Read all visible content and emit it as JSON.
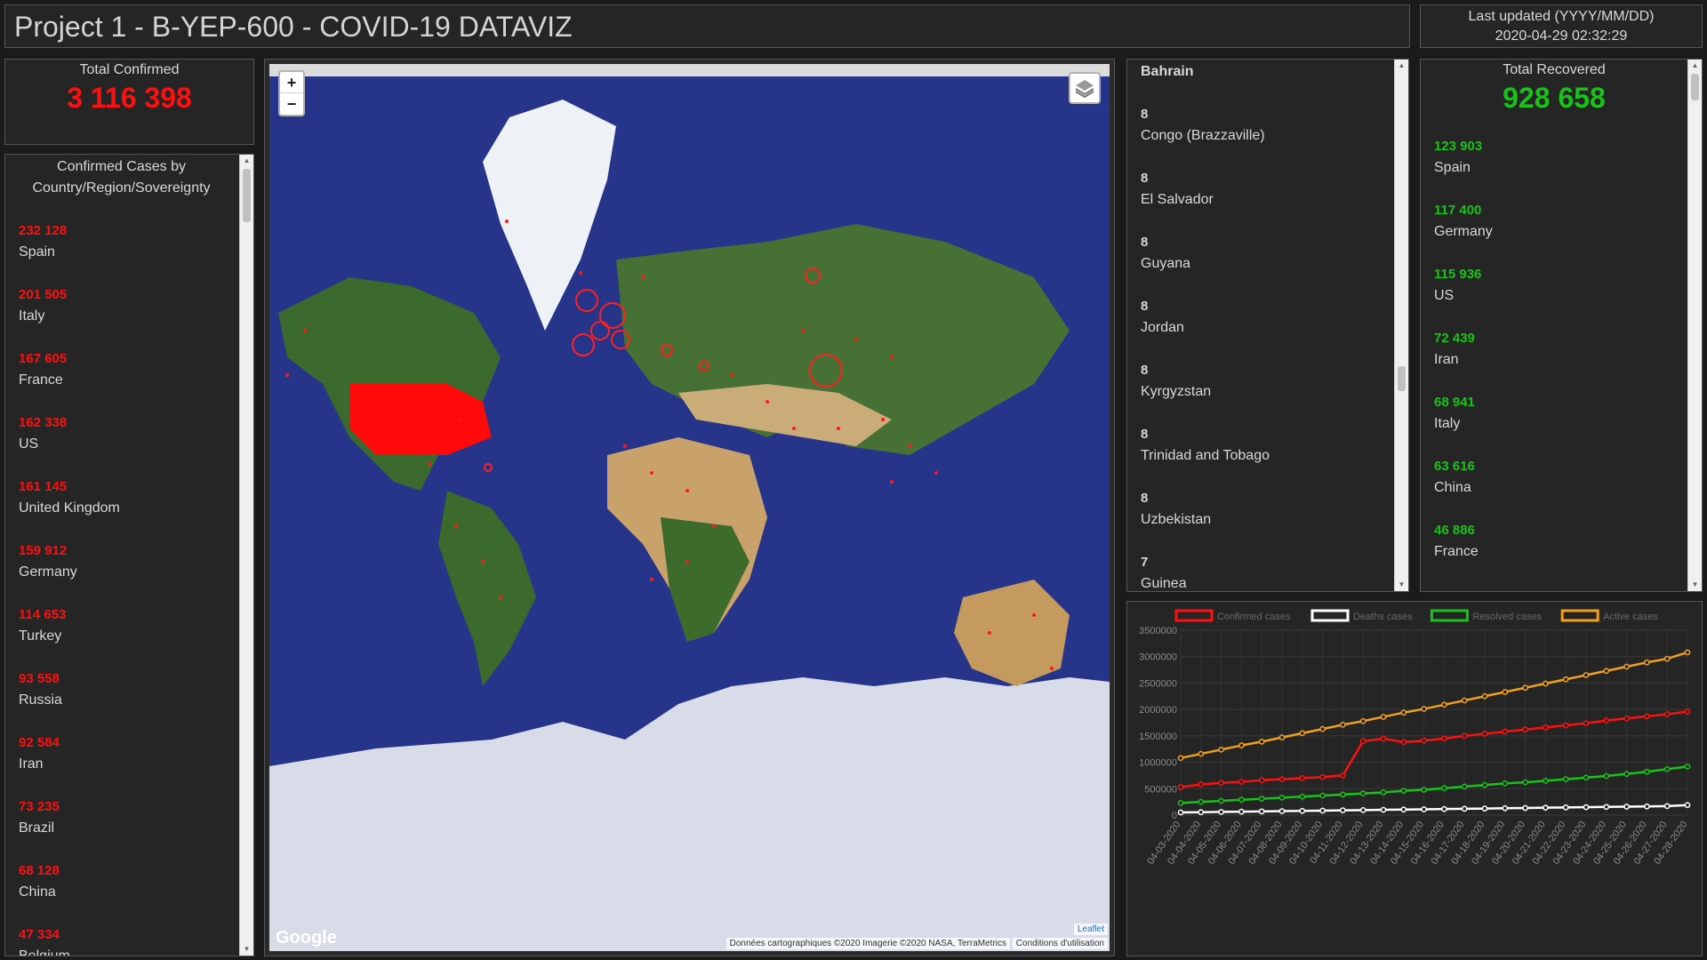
{
  "header": {
    "title": "Project 1 - B-YEP-600 - COVID-19 DATAVIZ"
  },
  "updated": {
    "label": "Last updated (YYYY/MM/DD)",
    "value": "2020-04-29 02:32:29"
  },
  "total_confirmed": {
    "label": "Total Confirmed",
    "value": "3 116 398"
  },
  "total_recovered": {
    "label": "Total Recovered",
    "value": "928 658"
  },
  "confirmed_list": {
    "title": "Confirmed Cases by Country/Region/Sovereignty",
    "items": [
      {
        "num": "232 128",
        "country": "Spain"
      },
      {
        "num": "201 505",
        "country": "Italy"
      },
      {
        "num": "167 605",
        "country": "France"
      },
      {
        "num": "162 338",
        "country": "US"
      },
      {
        "num": "161 145",
        "country": "United Kingdom"
      },
      {
        "num": "159 912",
        "country": "Germany"
      },
      {
        "num": "114 653",
        "country": "Turkey"
      },
      {
        "num": "93 558",
        "country": "Russia"
      },
      {
        "num": "92 584",
        "country": "Iran"
      },
      {
        "num": "73 235",
        "country": "Brazil"
      },
      {
        "num": "68 128",
        "country": "China"
      },
      {
        "num": "47 334",
        "country": "Belgium"
      }
    ]
  },
  "deaths_list": {
    "top_country": "Bahrain",
    "items": [
      {
        "num": "8",
        "country": "Congo (Brazzaville)"
      },
      {
        "num": "8",
        "country": "El Salvador"
      },
      {
        "num": "8",
        "country": "Guyana"
      },
      {
        "num": "8",
        "country": "Jordan"
      },
      {
        "num": "8",
        "country": "Kyrgyzstan"
      },
      {
        "num": "8",
        "country": "Trinidad and Tobago"
      },
      {
        "num": "8",
        "country": "Uzbekistan"
      },
      {
        "num": "7",
        "country": "Guinea"
      }
    ]
  },
  "recovered_list": {
    "items": [
      {
        "num": "123 903",
        "country": "Spain"
      },
      {
        "num": "117 400",
        "country": "Germany"
      },
      {
        "num": "115 936",
        "country": "US"
      },
      {
        "num": "72 439",
        "country": "Iran"
      },
      {
        "num": "68 941",
        "country": "Italy"
      },
      {
        "num": "63 616",
        "country": "China"
      },
      {
        "num": "46 886",
        "country": "France"
      }
    ]
  },
  "map": {
    "zoom_in": "+",
    "zoom_out": "−",
    "google_logo": "Google",
    "attribution": "Données cartographiques ©2020 Imagerie ©2020 NASA, TerraMetrics",
    "terms": "Conditions d'utilisation",
    "leaflet": "Leaflet",
    "layers_icon": "layers-icon"
  },
  "colors": {
    "confirmed": "#ff1010",
    "deaths": "#ffffff",
    "resolved": "#19c219",
    "active": "#f0a020"
  },
  "chart_data": {
    "type": "line",
    "x": [
      "04-03-2020",
      "04-04-2020",
      "04-05-2020",
      "04-06-2020",
      "04-07-2020",
      "04-08-2020",
      "04-09-2020",
      "04-10-2020",
      "04-11-2020",
      "04-12-2020",
      "04-13-2020",
      "04-14-2020",
      "04-15-2020",
      "04-16-2020",
      "04-17-2020",
      "04-18-2020",
      "04-19-2020",
      "04-20-2020",
      "04-21-2020",
      "04-22-2020",
      "04-23-2020",
      "04-24-2020",
      "04-25-2020",
      "04-26-2020",
      "04-27-2020",
      "04-28-2020"
    ],
    "yticks": [
      "0",
      "500000",
      "1000000",
      "1500000",
      "2000000",
      "2500000",
      "3000000",
      "3500000"
    ],
    "ylim": [
      0,
      3500000
    ],
    "legend_position": "top",
    "series": [
      {
        "name": "Confirmed cases",
        "color": "#ff1010",
        "values": [
          530000,
          580000,
          610000,
          630000,
          660000,
          680000,
          700000,
          720000,
          750000,
          1400000,
          1450000,
          1380000,
          1410000,
          1450000,
          1500000,
          1540000,
          1580000,
          1620000,
          1660000,
          1700000,
          1740000,
          1790000,
          1830000,
          1870000,
          1910000,
          1960000
        ]
      },
      {
        "name": "Deaths cases",
        "color": "#ffffff",
        "values": [
          50000,
          55000,
          60000,
          65000,
          70000,
          75000,
          80000,
          85000,
          90000,
          95000,
          100000,
          105000,
          110000,
          115000,
          120000,
          125000,
          130000,
          135000,
          140000,
          145000,
          150000,
          155000,
          160000,
          165000,
          170000,
          190000
        ]
      },
      {
        "name": "Resolved cases",
        "color": "#19c219",
        "values": [
          230000,
          250000,
          270000,
          290000,
          310000,
          330000,
          350000,
          370000,
          390000,
          410000,
          430000,
          460000,
          480000,
          510000,
          540000,
          570000,
          600000,
          620000,
          650000,
          680000,
          710000,
          740000,
          780000,
          820000,
          870000,
          920000
        ]
      },
      {
        "name": "Active cases",
        "color": "#f0a020",
        "values": [
          1080000,
          1160000,
          1240000,
          1320000,
          1390000,
          1470000,
          1550000,
          1630000,
          1710000,
          1780000,
          1860000,
          1940000,
          2010000,
          2090000,
          2170000,
          2250000,
          2330000,
          2410000,
          2490000,
          2570000,
          2650000,
          2730000,
          2810000,
          2890000,
          2960000,
          3080000
        ]
      }
    ]
  }
}
